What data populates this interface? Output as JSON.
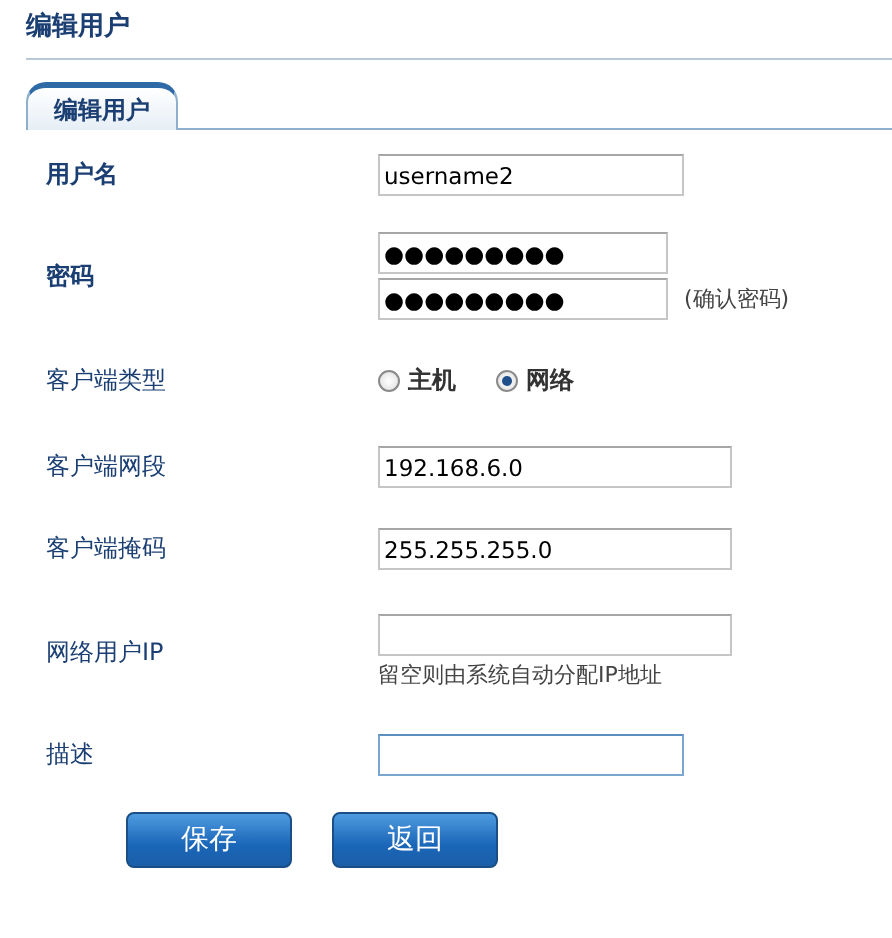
{
  "page_title": "编辑用户",
  "tabs": [
    {
      "label": "编辑用户",
      "selected": true
    }
  ],
  "fields": [
    {
      "kind": "text",
      "label": "用户名",
      "emphasized": true,
      "value": "username2",
      "focused": false
    },
    {
      "kind": "password",
      "label": "密码",
      "emphasized": true,
      "value": "●●●●●●●●●",
      "confirm_value": "●●●●●●●●●",
      "confirm_note": "(确认密码)"
    },
    {
      "kind": "radio",
      "label": "客户端类型",
      "emphasized": false,
      "options": [
        {
          "label": "主机",
          "selected": false
        },
        {
          "label": "网络",
          "selected": true
        }
      ]
    },
    {
      "kind": "text",
      "label": "客户端网段",
      "emphasized": false,
      "value": "192.168.6.0",
      "focused": false
    },
    {
      "kind": "text",
      "label": "客户端掩码",
      "emphasized": false,
      "value": "255.255.255.0",
      "focused": false
    },
    {
      "kind": "text",
      "label": "网络用户IP",
      "emphasized": false,
      "focused": false,
      "hint": "留空则由系统自动分配IP地址"
    },
    {
      "kind": "text",
      "label": "描述",
      "emphasized": false,
      "focused": true
    }
  ],
  "buttons": [
    "保存",
    "返回"
  ]
}
